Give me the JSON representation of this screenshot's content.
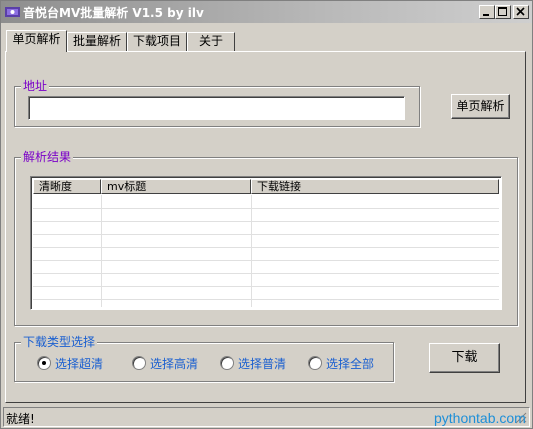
{
  "window": {
    "title": "音悦台MV批量解析 V1.5 by ilv",
    "controls": [
      "minimize",
      "maximize",
      "close"
    ]
  },
  "tabs": [
    {
      "label": "单页解析",
      "active": true
    },
    {
      "label": "批量解析",
      "active": false
    },
    {
      "label": "下载项目",
      "active": false
    },
    {
      "label": "关于",
      "active": false
    }
  ],
  "address": {
    "group_label": "地址",
    "value": "",
    "parse_button": "单页解析"
  },
  "results": {
    "group_label": "解析结果",
    "columns": [
      "清晰度",
      "mv标题",
      "下载链接"
    ],
    "rows": []
  },
  "download_type": {
    "group_label": "下载类型选择",
    "options": [
      {
        "label": "选择超清",
        "selected": true
      },
      {
        "label": "选择高清",
        "selected": false
      },
      {
        "label": "选择普清",
        "selected": false
      },
      {
        "label": "选择全部",
        "selected": false
      }
    ],
    "download_button": "下载"
  },
  "status": {
    "text": "就绪!"
  },
  "watermark": "pythontab.com",
  "colors": {
    "group_label": "#7a00c8",
    "radio_label": "#1a5fd0",
    "watermark": "#1e8fd8",
    "face": "#d4d0c8"
  }
}
